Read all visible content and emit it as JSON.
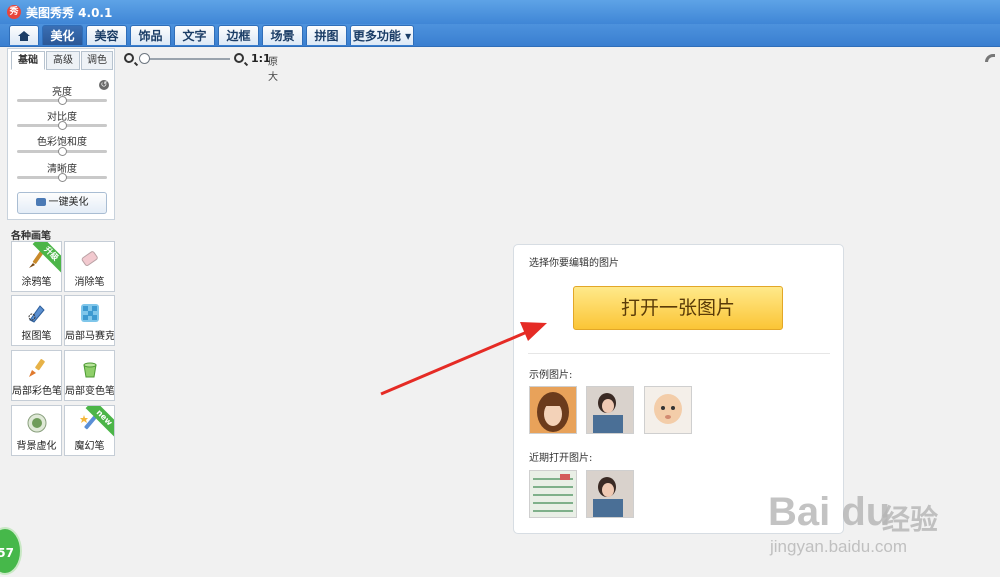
{
  "window": {
    "title": "美图秀秀 4.0.1",
    "icon_glyph": "秀"
  },
  "menu": {
    "tabs": [
      {
        "label": "美化",
        "active": true
      },
      {
        "label": "美容"
      },
      {
        "label": "饰品"
      },
      {
        "label": "文字"
      },
      {
        "label": "边框"
      },
      {
        "label": "场景"
      },
      {
        "label": "拼图"
      },
      {
        "label": "更多功能 ▾"
      }
    ]
  },
  "adjust": {
    "tabs": [
      "基础",
      "高级",
      "调色"
    ],
    "active_tab": "基础",
    "sliders": [
      {
        "label": "亮度",
        "value": 0.5
      },
      {
        "label": "对比度",
        "value": 0.5
      },
      {
        "label": "色彩饱和度",
        "value": 0.5
      },
      {
        "label": "清晰度",
        "value": 0.5
      }
    ],
    "one_click_label": "一键美化"
  },
  "brushes": {
    "title": "各种画笔",
    "tools": [
      {
        "label": "涂鸦笔",
        "badge": "升级",
        "icon": "brush-icon"
      },
      {
        "label": "消除笔",
        "icon": "eraser-icon"
      },
      {
        "label": "抠图笔",
        "icon": "cutout-pen-icon"
      },
      {
        "label": "局部马赛克",
        "icon": "mosaic-icon"
      },
      {
        "label": "局部彩色笔",
        "icon": "color-brush-icon"
      },
      {
        "label": "局部变色笔",
        "icon": "paint-bucket-icon"
      },
      {
        "label": "背景虚化",
        "icon": "blur-icon"
      },
      {
        "label": "魔幻笔",
        "badge": "new",
        "icon": "magic-pen-icon"
      }
    ]
  },
  "zoom": {
    "ratio": "1:1",
    "original_label": "原大",
    "value": 0.0
  },
  "open_panel": {
    "header": "选择你要编辑的图片",
    "open_button": "打开一张图片",
    "sample_label": "示例图片:",
    "recent_label": "近期打开图片:"
  },
  "watermark": {
    "logo": "Bai du",
    "cn": "经验",
    "url": "jingyan.baidu.com"
  },
  "badge": {
    "value": "57"
  },
  "colors": {
    "titlebar": "#4a94e0",
    "accent_button": "#fbc536",
    "arrow": "#e52b25"
  }
}
